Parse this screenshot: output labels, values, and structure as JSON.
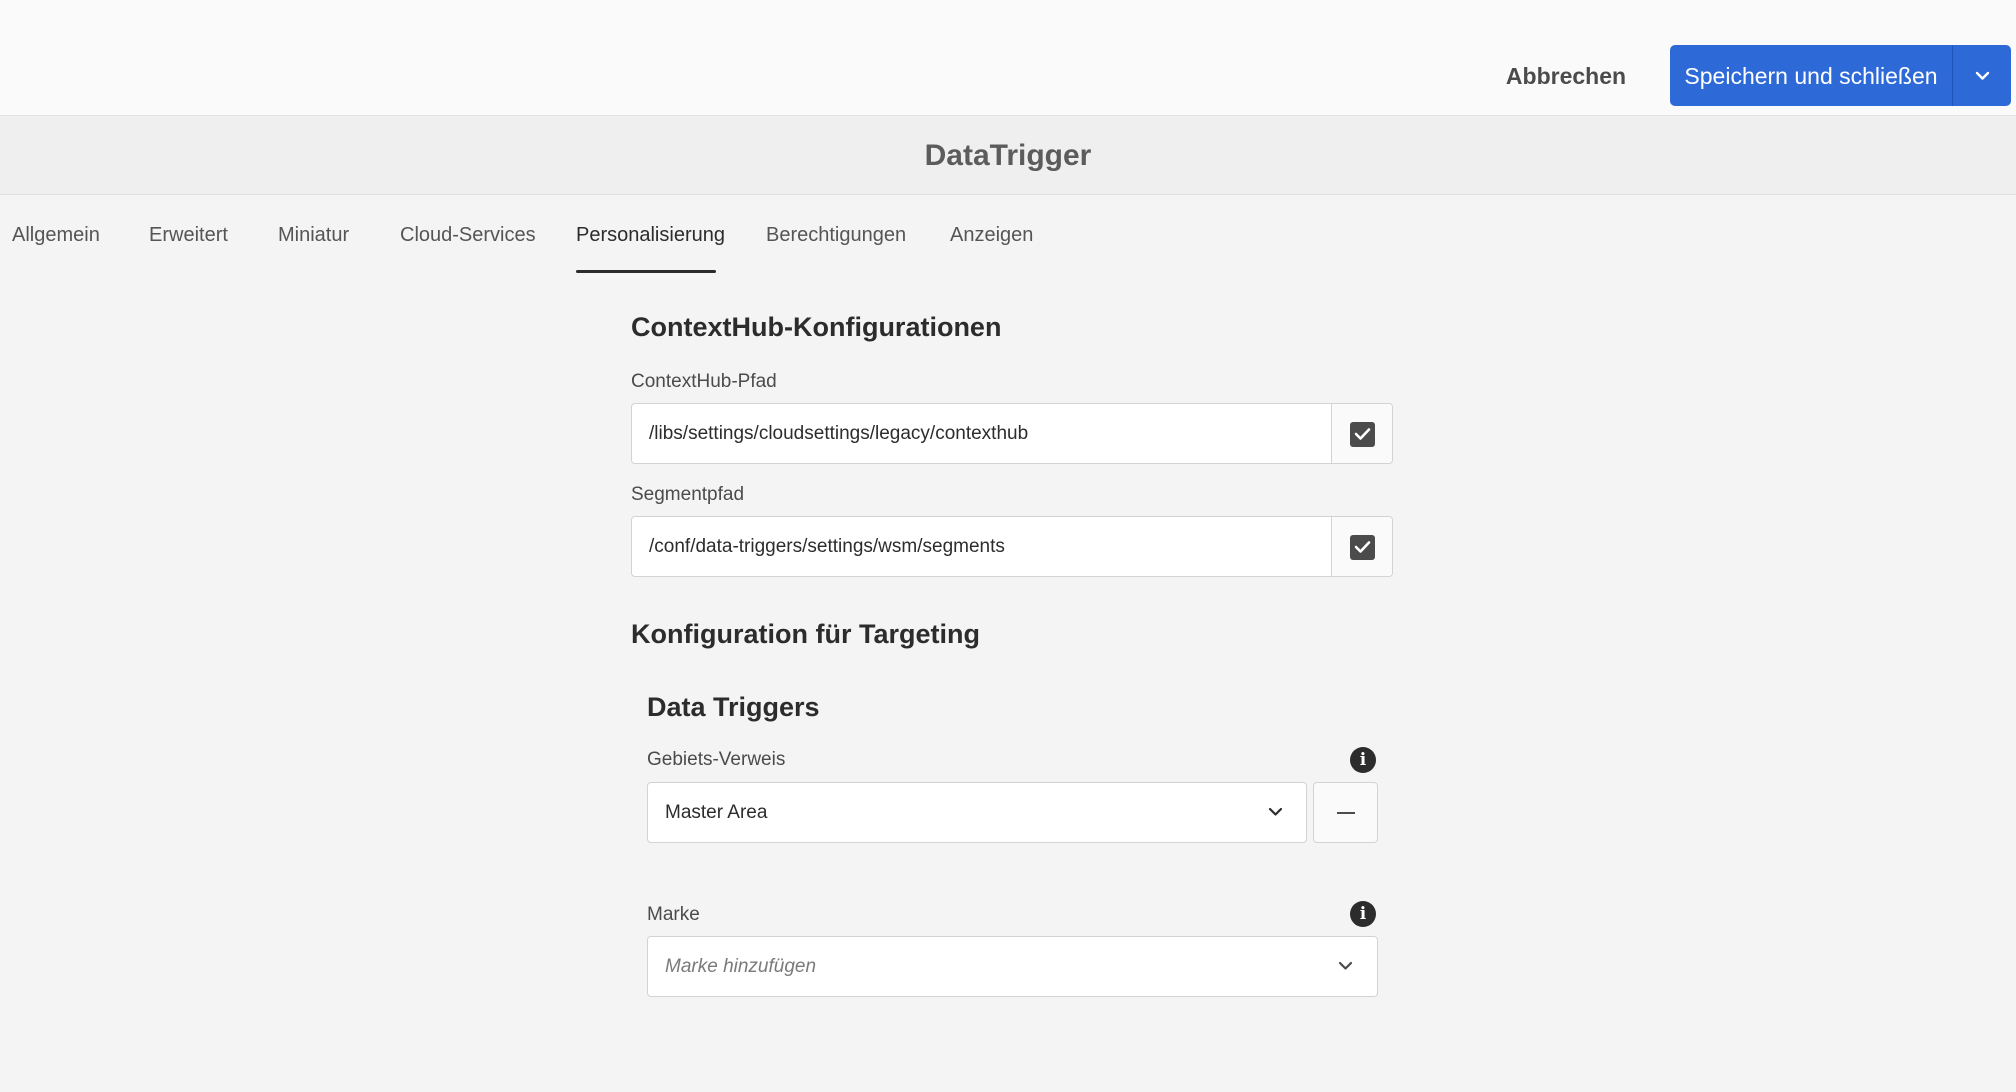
{
  "toolbar": {
    "cancel_label": "Abbrechen",
    "save_label": "Speichern und schließen",
    "save_menu_icon": "chevron-down-icon"
  },
  "page": {
    "title": "DataTrigger"
  },
  "tabs": [
    {
      "label": "Allgemein",
      "active": false
    },
    {
      "label": "Erweitert",
      "active": false
    },
    {
      "label": "Miniatur",
      "active": false
    },
    {
      "label": "Cloud-Services",
      "active": false
    },
    {
      "label": "Personalisierung",
      "active": true
    },
    {
      "label": "Berechtigungen",
      "active": false
    },
    {
      "label": "Anzeigen",
      "active": false
    }
  ],
  "contexthub": {
    "heading": "ContextHub-Konfigurationen",
    "path_label": "ContextHub-Pfad",
    "path_value": "/libs/settings/cloudsettings/legacy/contexthub",
    "segment_label": "Segmentpfad",
    "segment_value": "/conf/data-triggers/settings/wsm/segments"
  },
  "targeting": {
    "heading": "Konfiguration für Targeting",
    "subheading": "Data Triggers",
    "area_label": "Gebiets-Verweis",
    "area_value": "Master Area",
    "brand_label": "Marke",
    "brand_placeholder": "Marke hinzufügen"
  },
  "colors": {
    "primary": "#2d6ad8",
    "background": "#f4f4f4",
    "text": "#2c2c2c"
  }
}
